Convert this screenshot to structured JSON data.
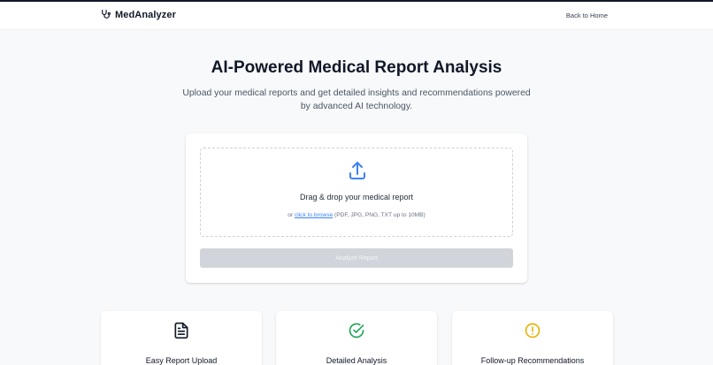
{
  "navbar": {
    "brand_icon": "stethoscope-icon",
    "brand_name": "MedAnalyzer",
    "back_link": "Back to Home"
  },
  "hero": {
    "title": "AI-Powered Medical Report Analysis",
    "subtitle": "Upload your medical reports and get detailed insights and recommendations powered by advanced AI technology."
  },
  "upload": {
    "icon": "upload-icon",
    "drop_title": "Drag & drop your medical report",
    "hint_prefix": "or ",
    "browse_link": "click to browse",
    "hint_suffix": " (PDF, JPG, PNG, TXT up to 10MB)",
    "analyze_button": "Analyze Report",
    "analyze_enabled": false
  },
  "features": [
    {
      "icon": "document-icon",
      "title": "Easy Report Upload",
      "color": "#111827"
    },
    {
      "icon": "check-circle-icon",
      "title": "Detailed Analysis",
      "color": "#22a55a"
    },
    {
      "icon": "alert-circle-icon",
      "title": "Follow-up Recommendations",
      "color": "#eab308"
    }
  ],
  "colors": {
    "accent": "#3b82f6",
    "disabled_button": "#d1d5db",
    "background": "#f8f9fb"
  }
}
